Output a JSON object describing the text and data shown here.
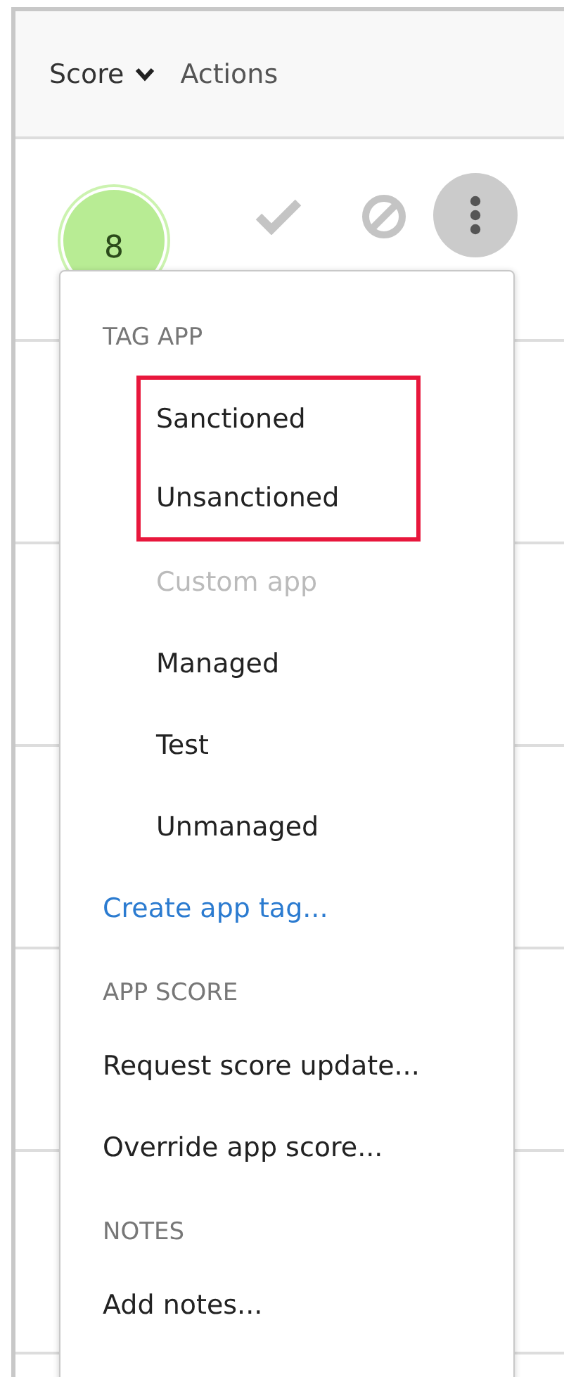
{
  "columns": [
    {
      "label": "Score",
      "sortable": true
    },
    {
      "label": "Actions",
      "sortable": false
    }
  ],
  "row": {
    "score": "8"
  },
  "menu": {
    "sections": [
      {
        "heading": "TAG APP",
        "items": [
          {
            "label": "Sanctioned",
            "kind": "tag",
            "disabled": false,
            "highlighted": true
          },
          {
            "label": "Unsanctioned",
            "kind": "tag",
            "disabled": false,
            "highlighted": true
          },
          {
            "label": "Custom app",
            "kind": "tag",
            "disabled": true,
            "highlighted": false
          },
          {
            "label": "Managed",
            "kind": "tag",
            "disabled": false,
            "highlighted": false
          },
          {
            "label": "Test",
            "kind": "tag",
            "disabled": false,
            "highlighted": false
          },
          {
            "label": "Unmanaged",
            "kind": "tag",
            "disabled": false,
            "highlighted": false
          },
          {
            "label": "Create app tag...",
            "kind": "link",
            "disabled": false,
            "highlighted": false
          }
        ]
      },
      {
        "heading": "APP SCORE",
        "items": [
          {
            "label": "Request score update...",
            "kind": "action",
            "disabled": false,
            "highlighted": false
          },
          {
            "label": "Override app score...",
            "kind": "action",
            "disabled": false,
            "highlighted": false
          }
        ]
      },
      {
        "heading": "NOTES",
        "items": [
          {
            "label": "Add notes...",
            "kind": "action",
            "disabled": false,
            "highlighted": false
          }
        ]
      }
    ]
  }
}
